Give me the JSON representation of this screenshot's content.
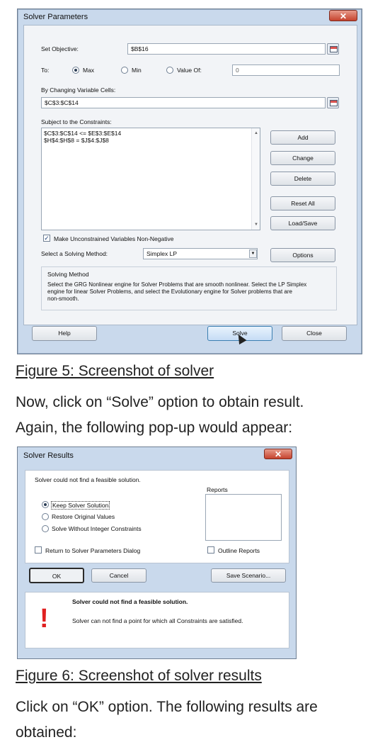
{
  "solver_params": {
    "title": "Solver Parameters",
    "close_glyph": "✕",
    "set_objective_label": "Set Objective:",
    "objective_value": "$B$16",
    "to_label": "To:",
    "opt_max": "Max",
    "opt_min": "Min",
    "opt_value_of": "Value Of:",
    "value_of": "0",
    "selected_option": "Max",
    "changing_cells_label": "By Changing Variable Cells:",
    "changing_cells_value": "$C$3:$C$14",
    "constraints_label": "Subject to the Constraints:",
    "constraints": [
      "$C$3:$C$14 <= $E$3:$E$14",
      "$H$4:$H$8 = $J$4:$J$8"
    ],
    "buttons": {
      "add": "Add",
      "change": "Change",
      "delete": "Delete",
      "reset_all": "Reset All",
      "load_save": "Load/Save",
      "options": "Options",
      "help": "Help",
      "solve": "Solve",
      "close": "Close"
    },
    "nonnegative_label": "Make Unconstrained Variables Non-Negative",
    "nonnegative_checked": true,
    "method_label": "Select a Solving Method:",
    "method_value": "Simplex LP",
    "method_group_title": "Solving Method",
    "method_desc_lines": [
      "Select the GRG Nonlinear engine for Solver Problems that are smooth nonlinear. Select the LP Simplex",
      "engine for linear Solver Problems, and select the Evolutionary engine for Solver problems that are",
      "non-smooth."
    ]
  },
  "caption1": "Figure 5: Screenshot of solver",
  "para1": "Now, click on “Solve” option to obtain result.",
  "para2": "Again, the following pop-up would appear:",
  "solver_results": {
    "title": "Solver Results",
    "close_glyph": "✕",
    "message": "Solver could not find a feasible solution.",
    "reports_label": "Reports",
    "options": [
      "Keep Solver Solution",
      "Restore Original Values",
      "Solve Without Integer Constraints"
    ],
    "selected_option": "Keep Solver Solution",
    "return_label": "Return to Solver Parameters Dialog",
    "outline_label": "Outline Reports",
    "buttons": {
      "ok": "OK",
      "cancel": "Cancel",
      "save_scenario": "Save Scenario..."
    },
    "alert_title": "Solver could not find a feasible solution.",
    "alert_body": "Solver can not find a point for which all Constraints are satisfied.",
    "alert_glyph": "!"
  },
  "caption2": "Figure 6: Screenshot of solver results",
  "para3": "Click on “OK” option. The following results are",
  "para4": "obtained:",
  "colors": {
    "dialog_frame": "#c9d9ec",
    "close_red": "#c6432e",
    "alert_red": "#e02020",
    "link_underline": "#222222"
  }
}
